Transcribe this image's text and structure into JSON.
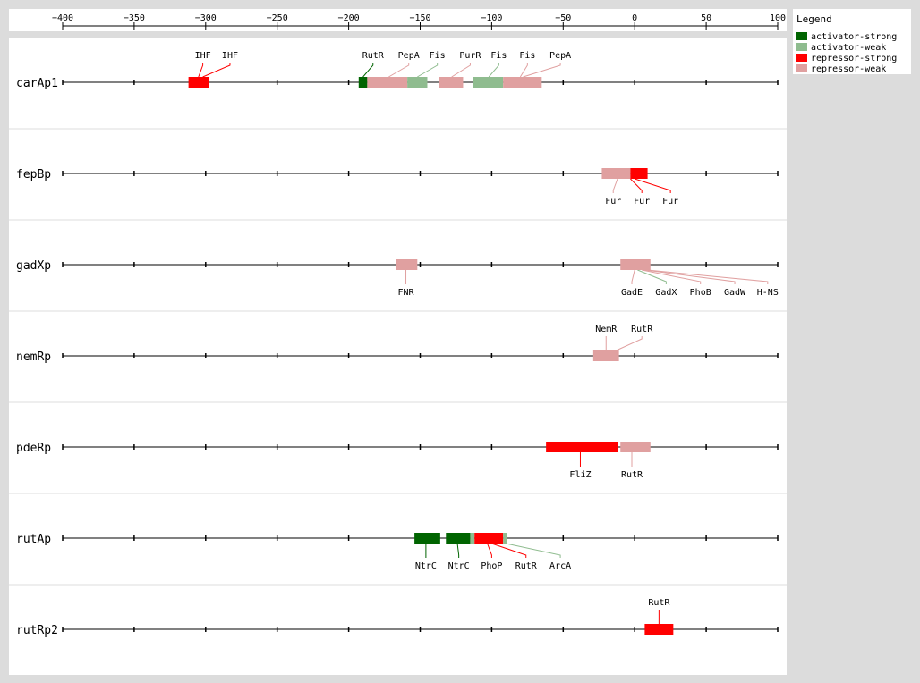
{
  "axis": {
    "ticks": [
      -400,
      -350,
      -300,
      -250,
      -200,
      -150,
      -100,
      -50,
      0,
      50,
      100
    ],
    "tick_labels": [
      "−400",
      "−350",
      "−300",
      "−250",
      "−200",
      "−150",
      "−100",
      "−50",
      "0",
      "50",
      "100"
    ],
    "range": [
      -400,
      100
    ]
  },
  "legend": {
    "title": "Legend",
    "items": [
      {
        "key": "activator-strong",
        "label": "activator-strong",
        "color": "#006400"
      },
      {
        "key": "activator-weak",
        "label": "activator-weak",
        "color": "#8fbc8f"
      },
      {
        "key": "repressor-strong",
        "label": "repressor-strong",
        "color": "#ff0000"
      },
      {
        "key": "repressor-weak",
        "label": "repressor-weak",
        "color": "#e0a0a0"
      }
    ]
  },
  "promoters": [
    {
      "name": "carAp1",
      "sites": [
        {
          "tf": "IHF",
          "start": -312,
          "end": -298,
          "type": "repressor-strong"
        },
        {
          "tf": "RutR",
          "start": -193,
          "end": -187,
          "type": "activator-strong"
        },
        {
          "tf": "PepA",
          "start": -187,
          "end": -159,
          "type": "repressor-weak"
        },
        {
          "tf": "Fis",
          "start": -159,
          "end": -145,
          "type": "activator-weak"
        },
        {
          "tf": "PurR",
          "start": -137,
          "end": -120,
          "type": "repressor-weak"
        },
        {
          "tf": "Fis",
          "start": -113,
          "end": -92,
          "type": "activator-weak"
        },
        {
          "tf": "PepA",
          "start": -92,
          "end": -65,
          "type": "repressor-weak"
        }
      ],
      "labels": [
        {
          "text": "IHF",
          "pos": -302,
          "anchor": -305,
          "side": "above",
          "type": "repressor-strong"
        },
        {
          "text": "IHF",
          "pos": -283,
          "anchor": -302,
          "side": "above",
          "type": "repressor-strong"
        },
        {
          "text": "RutR",
          "pos": -183,
          "anchor": -190,
          "side": "above",
          "type": "activator-strong"
        },
        {
          "text": "PepA",
          "pos": -158,
          "anchor": -172,
          "side": "above",
          "type": "repressor-weak"
        },
        {
          "text": "Fis",
          "pos": -138,
          "anchor": -152,
          "side": "above",
          "type": "activator-weak"
        },
        {
          "text": "PurR",
          "pos": -115,
          "anchor": -128,
          "side": "above",
          "type": "repressor-weak"
        },
        {
          "text": "Fis",
          "pos": -95,
          "anchor": -102,
          "side": "above",
          "type": "activator-weak"
        },
        {
          "text": "Fis",
          "pos": -75,
          "anchor": -80,
          "side": "above",
          "type": "repressor-weak"
        },
        {
          "text": "PepA",
          "pos": -52,
          "anchor": -78,
          "side": "above",
          "type": "repressor-weak"
        }
      ]
    },
    {
      "name": "fepBp",
      "sites": [
        {
          "tf": "Fur",
          "start": -23,
          "end": -3,
          "type": "repressor-weak"
        },
        {
          "tf": "Fur",
          "start": -3,
          "end": 9,
          "type": "repressor-strong"
        }
      ],
      "labels": [
        {
          "text": "Fur",
          "pos": -15,
          "anchor": -12,
          "side": "below",
          "type": "repressor-weak"
        },
        {
          "text": "Fur",
          "pos": 5,
          "anchor": -3,
          "side": "below",
          "type": "repressor-strong"
        },
        {
          "text": "Fur",
          "pos": 25,
          "anchor": 0,
          "side": "below",
          "type": "repressor-strong"
        }
      ]
    },
    {
      "name": "gadXp",
      "sites": [
        {
          "tf": "FNR",
          "start": -167,
          "end": -152,
          "type": "repressor-weak"
        },
        {
          "tf": "GadE",
          "start": -10,
          "end": 11,
          "type": "repressor-weak"
        }
      ],
      "labels": [
        {
          "text": "FNR",
          "pos": -160,
          "anchor": -160,
          "side": "below",
          "type": "repressor-weak"
        },
        {
          "text": "GadE",
          "pos": -2,
          "anchor": 0,
          "side": "below",
          "type": "repressor-weak"
        },
        {
          "text": "GadX",
          "pos": 22,
          "anchor": 2,
          "side": "below",
          "type": "activator-weak"
        },
        {
          "text": "PhoB",
          "pos": 46,
          "anchor": 5,
          "side": "below",
          "type": "repressor-weak"
        },
        {
          "text": "GadW",
          "pos": 70,
          "anchor": 7,
          "side": "below",
          "type": "repressor-weak"
        },
        {
          "text": "H-NS",
          "pos": 93,
          "anchor": 9,
          "side": "below",
          "type": "repressor-weak"
        }
      ]
    },
    {
      "name": "nemRp",
      "sites": [
        {
          "tf": "NemR",
          "start": -29,
          "end": -11,
          "type": "repressor-weak"
        }
      ],
      "labels": [
        {
          "text": "NemR",
          "pos": -20,
          "anchor": -20,
          "side": "above",
          "type": "repressor-weak"
        },
        {
          "text": "RutR",
          "pos": 5,
          "anchor": -13,
          "side": "above",
          "type": "repressor-weak"
        }
      ]
    },
    {
      "name": "pdeRp",
      "sites": [
        {
          "tf": "FliZ",
          "start": -62,
          "end": -12,
          "type": "repressor-strong"
        },
        {
          "tf": "RutR",
          "start": -10,
          "end": 11,
          "type": "repressor-weak"
        }
      ],
      "labels": [
        {
          "text": "FliZ",
          "pos": -38,
          "anchor": -38,
          "side": "below",
          "type": "repressor-strong"
        },
        {
          "text": "RutR",
          "pos": -2,
          "anchor": -2,
          "side": "below",
          "type": "repressor-weak"
        }
      ]
    },
    {
      "name": "rutAp",
      "sites": [
        {
          "tf": "NtrC",
          "start": -154,
          "end": -136,
          "type": "activator-strong"
        },
        {
          "tf": "NtrC",
          "start": -132,
          "end": -115,
          "type": "activator-strong"
        },
        {
          "tf": "PhoP",
          "start": -115,
          "end": -112,
          "type": "activator-weak"
        },
        {
          "tf": "RutR",
          "start": -112,
          "end": -92,
          "type": "repressor-strong"
        },
        {
          "tf": "ArcA",
          "start": -92,
          "end": -89,
          "type": "activator-weak"
        }
      ],
      "labels": [
        {
          "text": "NtrC",
          "pos": -146,
          "anchor": -146,
          "side": "below",
          "type": "activator-strong"
        },
        {
          "text": "NtrC",
          "pos": -123,
          "anchor": -124,
          "side": "below",
          "type": "activator-strong"
        },
        {
          "text": "PhoP",
          "pos": -100,
          "anchor": -103,
          "side": "below",
          "type": "repressor-strong"
        },
        {
          "text": "RutR",
          "pos": -76,
          "anchor": -100,
          "side": "below",
          "type": "repressor-strong"
        },
        {
          "text": "ArcA",
          "pos": -52,
          "anchor": -90,
          "side": "below",
          "type": "activator-weak"
        }
      ]
    },
    {
      "name": "rutRp2",
      "sites": [
        {
          "tf": "RutR",
          "start": 7,
          "end": 27,
          "type": "repressor-strong"
        }
      ],
      "labels": [
        {
          "text": "RutR",
          "pos": 17,
          "anchor": 17,
          "side": "above",
          "type": "repressor-strong"
        }
      ]
    }
  ]
}
